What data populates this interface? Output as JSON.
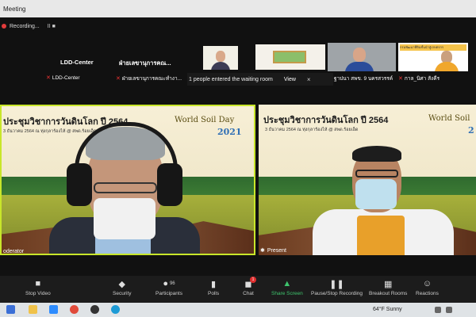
{
  "window": {
    "title": "Meeting"
  },
  "recording": {
    "label": "Recording...",
    "controls": "II  ■"
  },
  "strip": {
    "left_names": [
      "LDD-Center",
      "ฝ่ายเลขานุการคณ..."
    ],
    "left_labels": [
      "LDD-Center",
      "ฝ่ายเลขานุการคณะทำงา..."
    ],
    "right_labels": [
      "ฐาปนา สพข. 9 นครสวรรค์",
      "กาล_นิศา สังคีร"
    ],
    "thumb_text": "กรมพัฒนาที่ดินชั้นนำสู่เกษตรกร"
  },
  "waiting": {
    "message": "1 people entered the waiting room",
    "count_prefix": "1",
    "view": "View",
    "close": "×"
  },
  "left_video": {
    "title": "ประชุมวิชาการวันดินโลก ปี 2564",
    "subtitle": "3 ธันวาคม 2564 ณ ทุ่งกุลาร้องไห้ @ สพด.ร้อยเอ็ด",
    "brand": "World Soil Day",
    "year": "2021",
    "label": "oderator"
  },
  "right_video": {
    "title": "ประชุมวิชาการวันดินโลก ปี 2564",
    "subtitle": "3 ธันวาคม 2564 ณ ทุ่งกุลาร้องไห้ @ สพด.ร้อยเอ็ด",
    "brand": "World Soil",
    "year": "2",
    "label": "Present"
  },
  "toolbar": {
    "items": [
      {
        "label": "Stop Video",
        "icon": "video-icon"
      },
      {
        "label": "Security",
        "icon": "shield-icon"
      },
      {
        "label": "Participants",
        "icon": "participants-icon",
        "count": "96"
      },
      {
        "label": "Polls",
        "icon": "polls-icon"
      },
      {
        "label": "Chat",
        "icon": "chat-icon",
        "badge": "1"
      },
      {
        "label": "Share Screen",
        "icon": "share-screen-icon"
      },
      {
        "label": "Pause/Stop Recording",
        "icon": "record-icon"
      },
      {
        "label": "Breakout Rooms",
        "icon": "breakout-rooms-icon"
      },
      {
        "label": "Reactions",
        "icon": "reactions-icon"
      }
    ]
  },
  "taskbar": {
    "weather": "64°F  Sunny"
  },
  "colors": {
    "active_speaker": "#c8e62a",
    "share_green": "#3ec46d",
    "mic_off": "#e33333"
  }
}
